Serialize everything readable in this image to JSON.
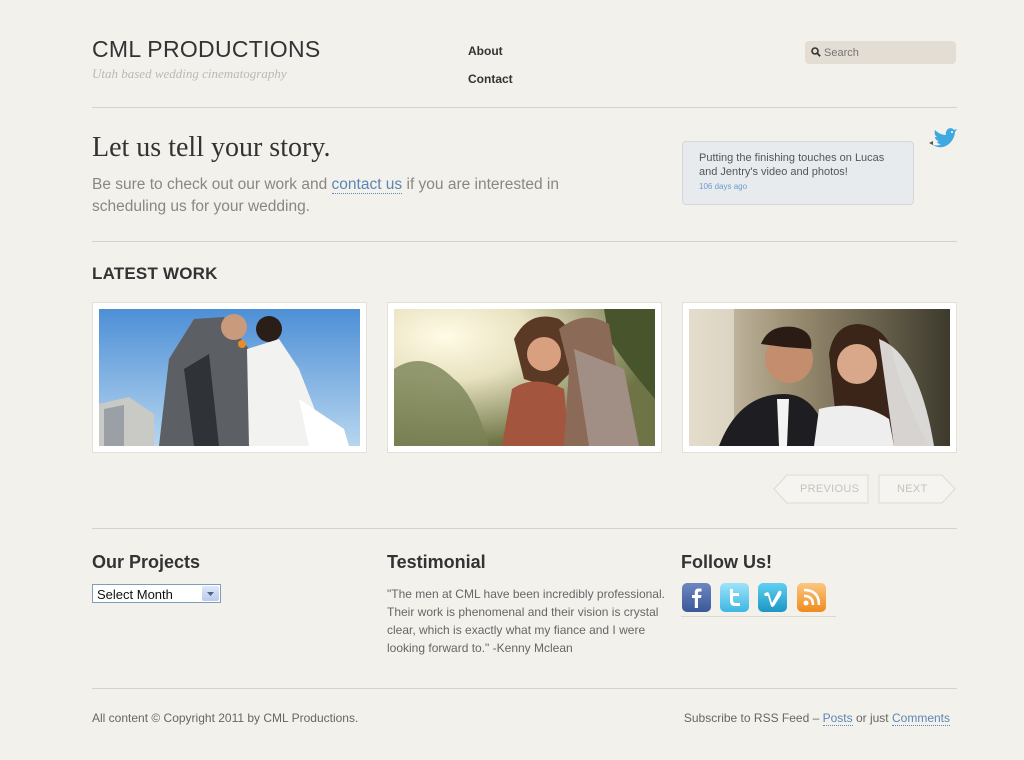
{
  "header": {
    "logo_name": "CML PRODUCTIONS",
    "tagline": "Utah based wedding cinematography",
    "nav": [
      "About",
      "Contact"
    ],
    "search_placeholder": "Search"
  },
  "intro": {
    "headline": "Let us tell your story.",
    "text_before": "Be sure to check out our work and ",
    "link_text": "contact us",
    "text_after": " if you are interested in scheduling us for your wedding."
  },
  "tweet": {
    "text": "Putting the finishing touches on Lucas and Jentry's video and photos!",
    "time": "106 days ago"
  },
  "latest_work": {
    "title": "LATEST WORK",
    "thumbnails": [
      "wedding-couple-kissing-photo",
      "couple-embracing-sunlight-photo",
      "bride-groom-smiling-photo"
    ],
    "prev_label": "PREVIOUS",
    "next_label": "NEXT"
  },
  "widgets": {
    "projects_title": "Our Projects",
    "projects_select": "Select Month",
    "testimonial_title": "Testimonial",
    "testimonial_text": "\"The men at CML have been incredibly professional. Their work is phenomenal and their vision is crystal clear, which is exactly what my fiance and I were looking forward to.\" -Kenny Mclean",
    "follow_title": "Follow Us!",
    "social_icons": [
      "facebook-icon",
      "twitter-icon",
      "vimeo-icon",
      "rss-icon"
    ]
  },
  "footer": {
    "copyright": "All content © Copyright 2011 by CML Productions.",
    "rss_prefix": "Subscribe to RSS Feed – ",
    "posts_link": "Posts",
    "middle": " or just ",
    "comments_link": "Comments"
  },
  "colors": {
    "background": "#f3f1ec",
    "link": "#5b86b6",
    "heading": "#333333",
    "facebook": "#3b5998",
    "twitter": "#33ccff",
    "vimeo": "#1ab7ea",
    "rss": "#f7941d"
  }
}
